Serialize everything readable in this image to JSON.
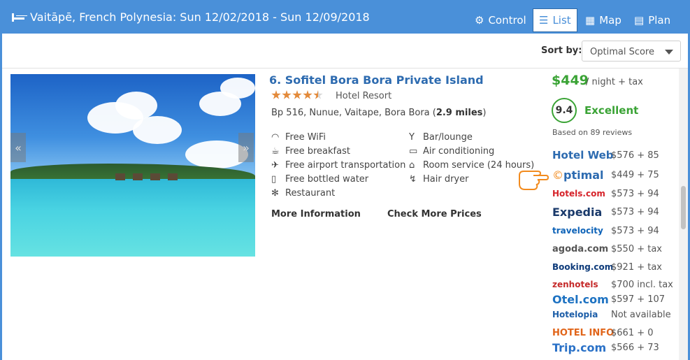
{
  "header": {
    "title": "Vaitāpē, French Polynesia: Sun 12/02/2018 - Sun 12/09/2018",
    "nav": {
      "control": "Control",
      "list": "List",
      "map": "Map",
      "plan": "Plan"
    }
  },
  "sort": {
    "label": "Sort by",
    "value": "Optimal Score"
  },
  "hotel": {
    "name": "6. Sofitel Bora Bora Private Island",
    "stars": 4.5,
    "type": "Hotel Resort",
    "address": "Bp 516, Nunue, Vaitape, Bora Bora (",
    "distance": "2.9 miles",
    "address_end": ")",
    "amenities_left": [
      "Free WiFi",
      "Free breakfast",
      "Free airport transportation",
      "Free bottled water",
      "Restaurant"
    ],
    "amenities_right": [
      "Bar/lounge",
      "Air conditioning",
      "Room service (24 hours)",
      "Hair dryer"
    ],
    "more_info": "More Information",
    "check_prices": "Check More Prices",
    "price": "$449",
    "price_suffix": "/ night + tax",
    "score": "9.4",
    "score_label": "Excellent",
    "reviews": "Based on 89 reviews"
  },
  "providers": [
    {
      "name": "Hotel Web",
      "price": "$576 + 85",
      "color": "#2d6bb0"
    },
    {
      "name": "ptimal",
      "price": "$449 + 75",
      "color": "#2d6bb0"
    },
    {
      "name": "Hotels.com",
      "price": "$573 + 94",
      "color": "#d6232a"
    },
    {
      "name": "Expedia",
      "price": "$573 + 94",
      "color": "#1a3a6b"
    },
    {
      "name": "travelocity",
      "price": "$573 + 94",
      "color": "#0e63b8"
    },
    {
      "name": "agoda.com",
      "price": "$550 + tax",
      "color": "#555555"
    },
    {
      "name": "Booking.com",
      "price": "$921 + tax",
      "color": "#0e3b7a"
    },
    {
      "name": "zenhotels",
      "price": "$700 incl. tax",
      "color": "#c52a2a"
    },
    {
      "name": "Otel.com",
      "price": "$597 + 107",
      "color": "#1d72c2"
    },
    {
      "name": "Hotelopia",
      "price": "Not available",
      "color": "#1d5ea8"
    },
    {
      "name": "HOTEL INFO",
      "price": "$661 + 0",
      "color": "#e1651a"
    },
    {
      "name": "Trip.com",
      "price": "$566 + 73",
      "color": "#2a71c7"
    }
  ],
  "colors": {
    "brand": "#4a90d9",
    "accent": "#3aa335",
    "star": "#e38a3a"
  }
}
